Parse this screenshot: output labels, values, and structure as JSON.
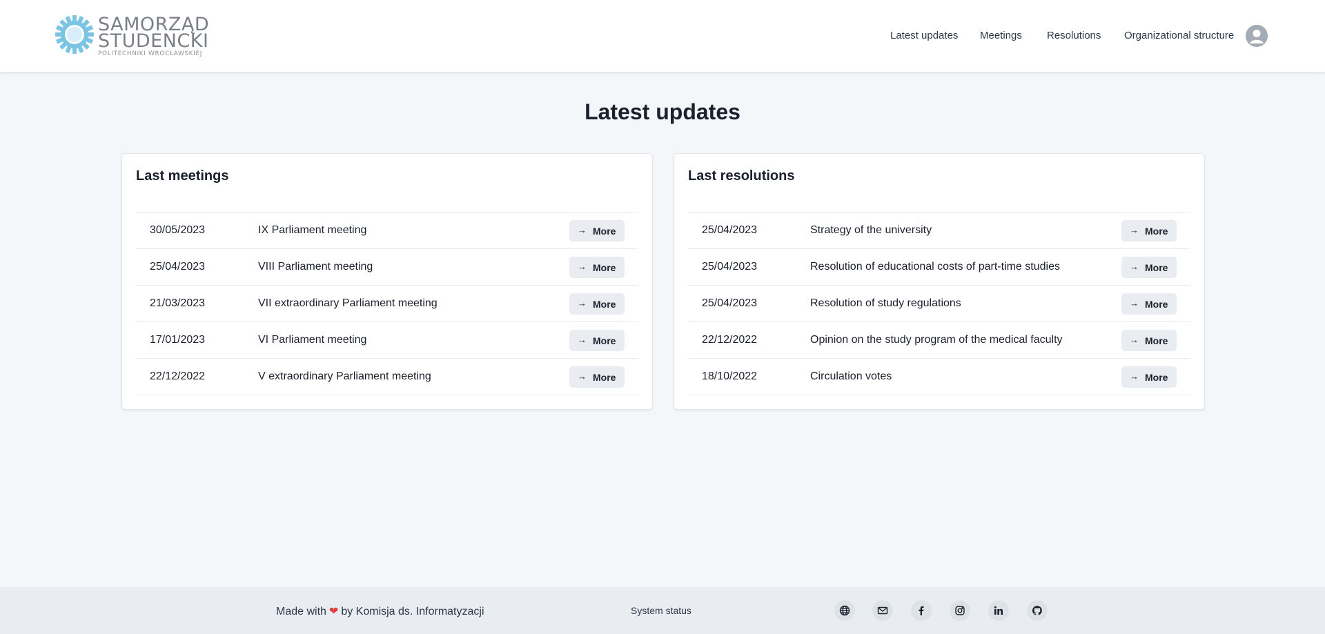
{
  "logo": {
    "line1": "SAMORZĄD",
    "line2": "STUDENCKI",
    "line3": "POLITECHNIKI WROCŁAWSKIEJ"
  },
  "nav": {
    "items": [
      "Latest updates",
      "Meetings",
      "Resolutions",
      "Organizational structure"
    ]
  },
  "page_title": "Latest updates",
  "meetings": {
    "title": "Last meetings",
    "rows": [
      {
        "date": "30/05/2023",
        "name": "IX Parliament meeting",
        "button": "More"
      },
      {
        "date": "25/04/2023",
        "name": "VIII Parliament meeting",
        "button": "More"
      },
      {
        "date": "21/03/2023",
        "name": "VII extraordinary Parliament meeting",
        "button": "More"
      },
      {
        "date": "17/01/2023",
        "name": "VI Parliament meeting",
        "button": "More"
      },
      {
        "date": "22/12/2022",
        "name": "V extraordinary Parliament meeting",
        "button": "More"
      }
    ]
  },
  "resolutions": {
    "title": "Last resolutions",
    "rows": [
      {
        "date": "25/04/2023",
        "name": "Strategy of the university",
        "button": "More"
      },
      {
        "date": "25/04/2023",
        "name": "Resolution of educational costs of part-time studies",
        "button": "More"
      },
      {
        "date": "25/04/2023",
        "name": "Resolution of study regulations",
        "button": "More"
      },
      {
        "date": "22/12/2022",
        "name": "Opinion on the study program of the medical faculty",
        "button": "More"
      },
      {
        "date": "18/10/2022",
        "name": "Circulation votes",
        "button": "More"
      }
    ]
  },
  "footer": {
    "made_prefix": "Made with",
    "made_suffix": "by Komisja ds. Informatyzacji",
    "status": "System status",
    "social_icons": [
      "globe-icon",
      "mail-icon",
      "facebook-icon",
      "instagram-icon",
      "linkedin-icon",
      "github-icon"
    ]
  },
  "colors": {
    "page_bg": "#f4f7fa",
    "heart": "#e53e3e",
    "logo_blue": "#7cc4e4",
    "button_bg": "#e9edf1"
  }
}
